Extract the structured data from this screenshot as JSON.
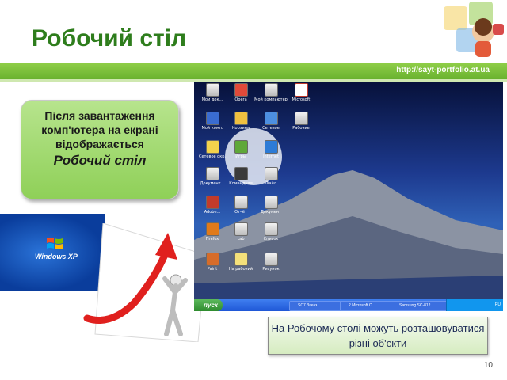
{
  "slide": {
    "title": "Робочий стіл",
    "url": "http://sayt-portfolio.at.ua",
    "page_number": "10"
  },
  "callout": {
    "text": "Після завантаження комп'ютера на екрані відображається",
    "emphasis": "Робочий стіл"
  },
  "caption": {
    "text": "На Робочому столі можуть розташовуватися різні об'єкти"
  },
  "windows_logo": {
    "label": "Windows XP"
  },
  "desktop": {
    "taskbar": {
      "start_label": "пуск",
      "buttons": [
        "SC7 Заказ...",
        "2 Microsoft C...",
        "Samsung SC-812"
      ],
      "tray_text": "RU"
    }
  },
  "colors": {
    "title": "#2e7d1c",
    "bar": "#7cc23b",
    "callout": "#a6dc74",
    "arrow": "#e0201e"
  }
}
